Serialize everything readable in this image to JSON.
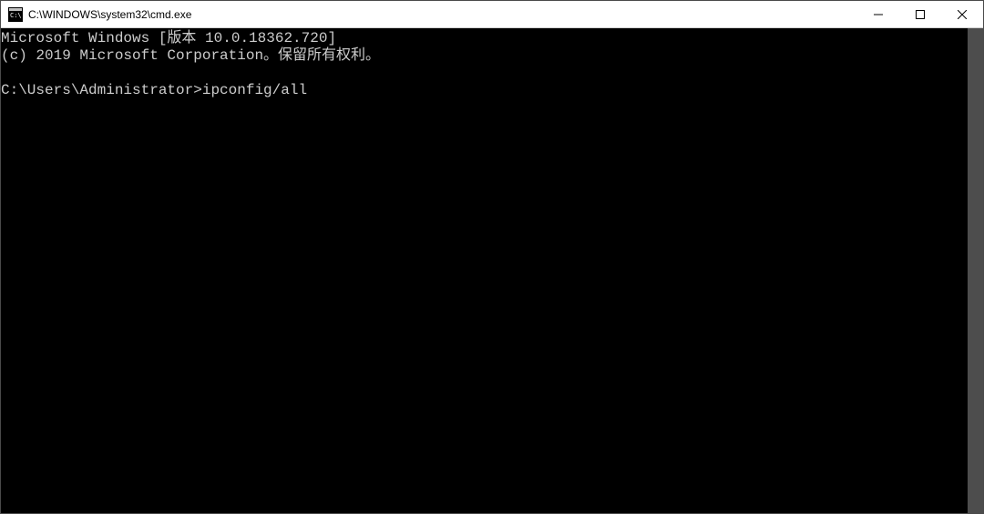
{
  "window": {
    "title": "C:\\WINDOWS\\system32\\cmd.exe"
  },
  "terminal": {
    "line1": "Microsoft Windows [版本 10.0.18362.720]",
    "line2": "(c) 2019 Microsoft Corporation。保留所有权利。",
    "blank": "",
    "prompt": "C:\\Users\\Administrator>",
    "command": "ipconfig/all"
  }
}
